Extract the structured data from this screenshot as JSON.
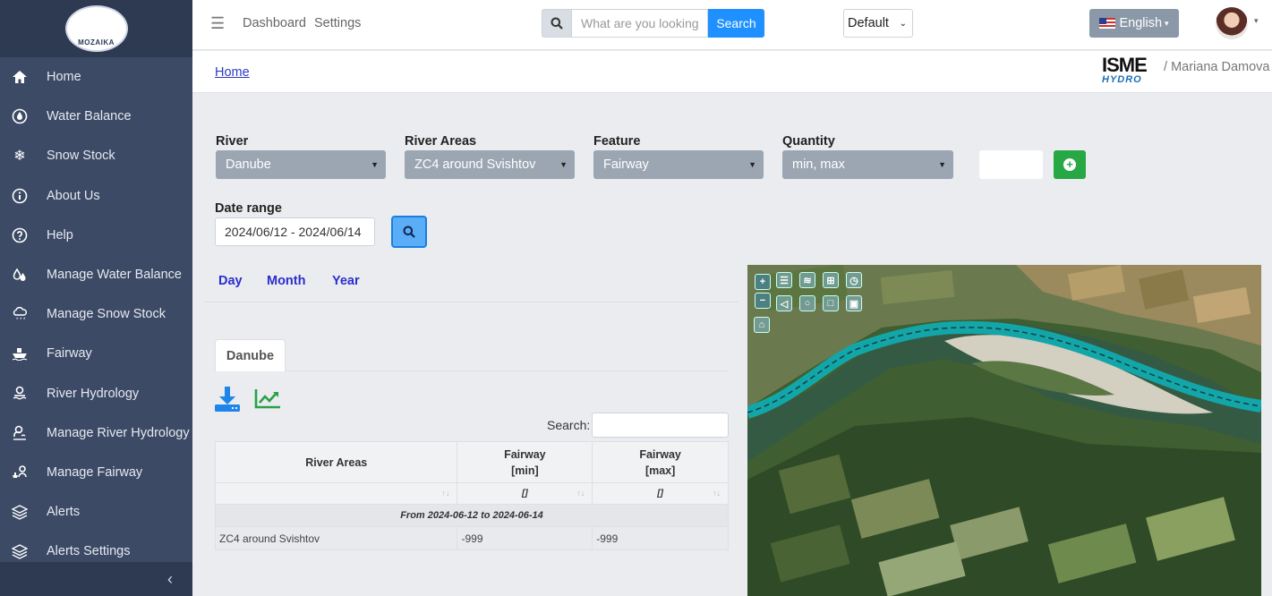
{
  "sidebar": {
    "logo_text": "MOZAIKA",
    "items": [
      {
        "label": "Home",
        "icon": "home-icon"
      },
      {
        "label": "Water Balance",
        "icon": "water-drop-icon"
      },
      {
        "label": "Snow Stock",
        "icon": "snowflake-icon"
      },
      {
        "label": "About Us",
        "icon": "info-icon"
      },
      {
        "label": "Help",
        "icon": "help-icon"
      },
      {
        "label": "Manage Water Balance",
        "icon": "water-drops-icon"
      },
      {
        "label": "Manage Snow Stock",
        "icon": "snow-cloud-icon"
      },
      {
        "label": "Fairway",
        "icon": "ship-icon"
      },
      {
        "label": "River Hydrology",
        "icon": "hydrology-icon"
      },
      {
        "label": "Manage River Hydrology",
        "icon": "user-hydrology-icon"
      },
      {
        "label": "Manage Fairway",
        "icon": "user-fairway-icon"
      },
      {
        "label": "Alerts",
        "icon": "layers-icon"
      },
      {
        "label": "Alerts Settings",
        "icon": "layers-settings-icon"
      }
    ],
    "collapse_icon": "chevron-left-icon"
  },
  "topbar": {
    "links": [
      "Dashboard",
      "Settings"
    ],
    "search_placeholder": "What are you looking for?",
    "search_button": "Search",
    "profile_select": "Default",
    "language": "English"
  },
  "breadcrumb": {
    "home": "Home",
    "logo_text": "ISME",
    "logo_sub": "HYDRO",
    "user": "Mariana Damova"
  },
  "filters": {
    "river": {
      "label": "River",
      "value": "Danube"
    },
    "river_areas": {
      "label": "River Areas",
      "value": "ZC4 around Svishtov"
    },
    "feature": {
      "label": "Feature",
      "value": "Fairway"
    },
    "quantity": {
      "label": "Quantity",
      "value": "min, max"
    },
    "date_range": {
      "label": "Date range",
      "value": "2024/06/12 - 2024/06/14"
    }
  },
  "periods": [
    "Day",
    "Month",
    "Year"
  ],
  "river_tab": "Danube",
  "table": {
    "search_label": "Search:",
    "headers": [
      "River Areas",
      "Fairway\n[min]",
      "Fairway\n[max]"
    ],
    "header_line1": [
      "River Areas",
      "Fairway",
      "Fairway"
    ],
    "header_line2": [
      "",
      "[min]",
      "[max]"
    ],
    "filters": [
      "",
      "[]",
      "[]"
    ],
    "group_label": "From 2024-06-12 to 2024-06-14",
    "rows": [
      [
        "ZC4 around Svishtov",
        "-999",
        "-999"
      ]
    ]
  },
  "colors": {
    "sidebar_bg": "#3c4a66",
    "accent_blue": "#1e90ff",
    "add_green": "#28a745",
    "fairway_cyan": "#12a6a8"
  }
}
